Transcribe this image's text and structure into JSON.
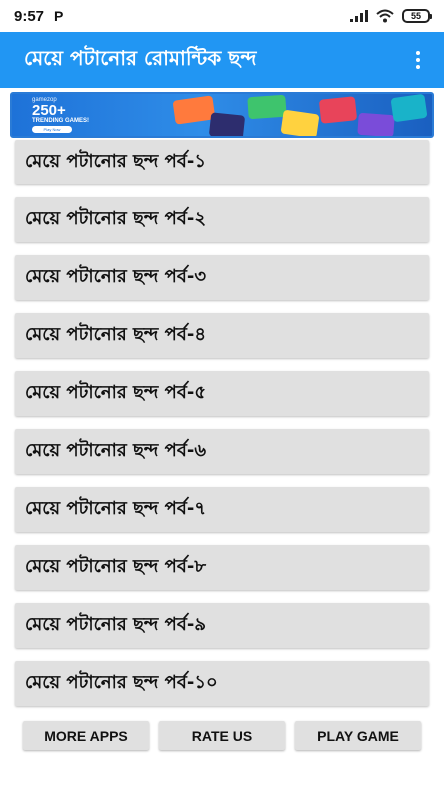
{
  "status_bar": {
    "time": "9:57",
    "notification_icon": "P",
    "battery": "55"
  },
  "app_bar": {
    "title": "মেয়ে পটানোর রোমান্টিক ছন্দ",
    "menu_icon": "overflow-menu-icon"
  },
  "banner": {
    "brand": "gamezop",
    "headline": "250+",
    "subline": "TRENDING GAMES!",
    "cta": "Play Now"
  },
  "list": {
    "items": [
      "মেয়ে পটানোর ছন্দ পর্ব-১",
      "মেয়ে পটানোর ছন্দ পর্ব-২",
      "মেয়ে পটানোর ছন্দ পর্ব-৩",
      "মেয়ে পটানোর ছন্দ পর্ব-৪",
      "মেয়ে পটানোর ছন্দ পর্ব-৫",
      "মেয়ে পটানোর ছন্দ পর্ব-৬",
      "মেয়ে পটানোর ছন্দ পর্ব-৭",
      "মেয়ে পটানোর ছন্দ পর্ব-৮",
      "মেয়ে পটানোর ছন্দ পর্ব-৯",
      "মেয়ে পটানোর ছন্দ পর্ব-১০"
    ]
  },
  "buttons": {
    "more_apps": "MORE APPS",
    "rate_us": "RATE US",
    "play_game": "PLAY GAME"
  },
  "colors": {
    "app_bar": "#2196f3",
    "list_item_bg": "#e0e0e0"
  }
}
